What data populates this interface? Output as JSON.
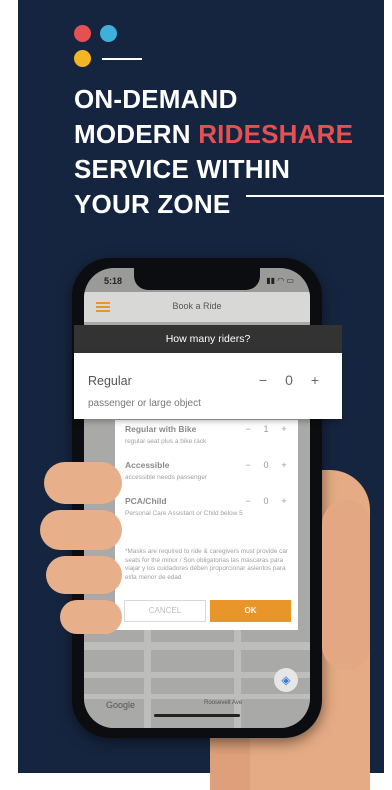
{
  "headline": {
    "line1": "ON-DEMAND",
    "line2_prefix": "MODERN ",
    "line2_accent": "RIDESHARE",
    "line3": "SERVICE WITHIN",
    "line4": "YOUR ZONE"
  },
  "phone": {
    "status_time": "5:18",
    "app_title": "Book a Ride",
    "google_label": "Google",
    "map_labels": [
      "Roosevelt Ave"
    ]
  },
  "dialog": {
    "title": "How many riders?",
    "callout": {
      "name": "Regular",
      "description": "passenger or large object",
      "minus": "−",
      "count": "0",
      "plus": "+"
    },
    "riders": [
      {
        "name": "Regular with Bike",
        "description": "regular seat plus a bike rack",
        "count": "1"
      },
      {
        "name": "Accessible",
        "description": "accessible needs passenger",
        "count": "0"
      },
      {
        "name": "PCA/Child",
        "description": "Personal Care Assistant or Child below 5",
        "count": "0"
      }
    ],
    "stepper_minus": "−",
    "stepper_plus": "+",
    "notice": "*Masks are required to ride & caregivers must provide car seats for the minor / Son obligatorias las máscaras para viajar y los cuidadores deben proporcionar asientos para el/la menor de edad",
    "cancel_label": "CANCEL",
    "ok_label": "OK"
  },
  "colors": {
    "background": "#16253f",
    "accent_red": "#e55050",
    "accent_blue": "#3fb0da",
    "accent_yellow": "#f4b524",
    "ok_button": "#e8952a"
  }
}
